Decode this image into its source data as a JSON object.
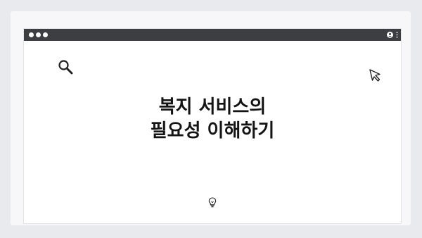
{
  "window": {
    "icons": {
      "controls": "window-controls-dots",
      "user": "user-icon",
      "menu": "kebab-menu-icon",
      "search": "search-icon",
      "cursor": "cursor-icon",
      "bulb": "lightbulb-icon"
    }
  },
  "content": {
    "title_line1": "복지 서비스의",
    "title_line2": "필요성 이해하기"
  },
  "colors": {
    "background": "#e9eaee",
    "titlebar": "#3d3e42",
    "window": "#ffffff",
    "text": "#141414"
  }
}
